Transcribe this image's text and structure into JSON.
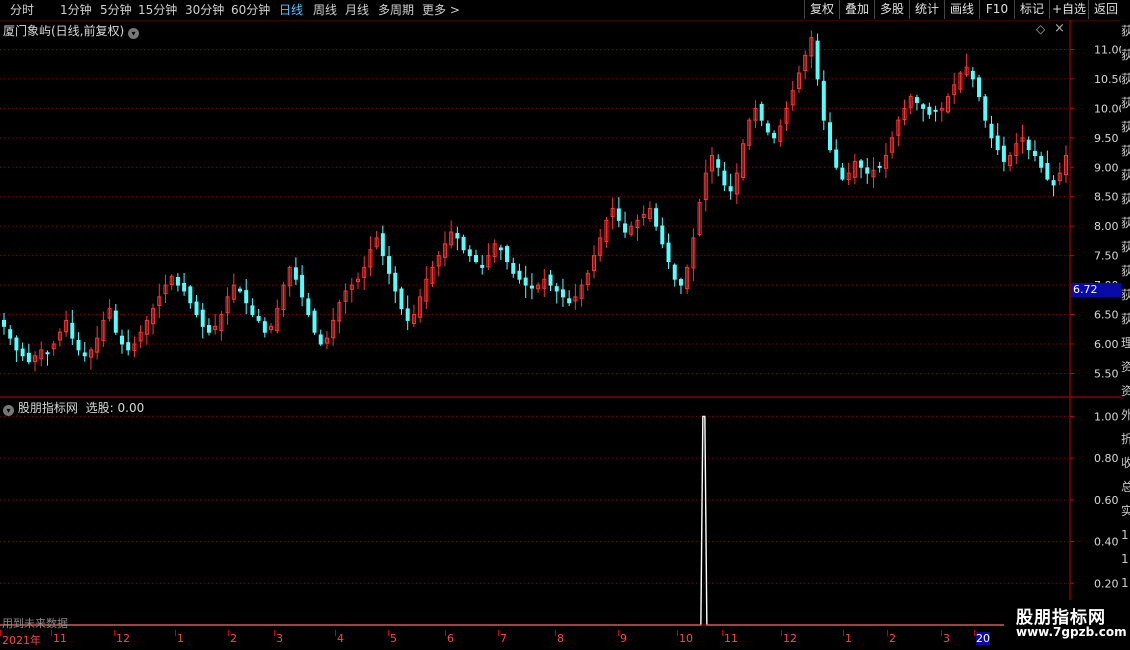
{
  "toolbar": {
    "periods": [
      "分时",
      "1分钟",
      "5分钟",
      "15分钟",
      "30分钟",
      "60分钟",
      "日线",
      "周线",
      "月线",
      "多周期",
      "更多 >"
    ],
    "active_index": 6,
    "right_buttons": [
      "复权",
      "叠加",
      "多股",
      "统计",
      "画线",
      "F10",
      "标记",
      "+自选",
      "返回"
    ]
  },
  "main": {
    "title": "厦门象屿(日线,前复权)",
    "diamond": "◇",
    "close_glyph": "×",
    "current_price": "6.72"
  },
  "indicator": {
    "title": "股朋指标网",
    "value_label": "选股: 0.00"
  },
  "note": "用到未来数据",
  "date_axis": {
    "labels": [
      "2021年",
      "11",
      "12",
      "1",
      "2",
      "3",
      "4",
      "5",
      "6",
      "7",
      "8",
      "9",
      "10",
      "11",
      "12",
      "1",
      "2",
      "3",
      "20"
    ]
  },
  "watermark": {
    "brand": "股朋指标网",
    "url": "www.7gpzb.com"
  },
  "right_panel_glyphs": [
    "荻",
    "荻",
    "荻",
    "荻",
    "荻",
    "荻",
    "荻",
    "荻",
    "荻",
    "荻",
    "荻",
    "荻",
    "荻",
    "理",
    "资",
    "资",
    "外",
    "折",
    "收",
    "总",
    "实",
    "1",
    "1",
    "1",
    "1",
    "1"
  ],
  "colors": {
    "up": "#ff3232",
    "down": "#54ffff",
    "active_tab": "#4fc3ff",
    "grid": "#7a0000",
    "axis": "#c80000",
    "price_tag_bg": "#0a0aa8"
  },
  "chart_data": [
    {
      "type": "candlestick",
      "y_axis_ticks": [
        "11.00",
        "10.50",
        "10.00",
        "9.50",
        "9.00",
        "8.50",
        "8.00",
        "7.50",
        "7.00",
        "6.50",
        "6.00",
        "5.50"
      ],
      "ylim": [
        5.1,
        11.5
      ],
      "close_series": [
        6.3,
        6.1,
        5.9,
        5.8,
        5.7,
        5.8,
        5.9,
        5.85,
        6.0,
        6.2,
        6.4,
        6.1,
        5.9,
        5.8,
        5.9,
        6.1,
        6.4,
        6.6,
        6.2,
        6.0,
        5.9,
        6.0,
        6.2,
        6.4,
        6.6,
        6.8,
        7.0,
        7.15,
        7.0,
        6.9,
        6.7,
        6.5,
        6.3,
        6.2,
        6.3,
        6.5,
        6.8,
        7.0,
        6.9,
        6.7,
        6.5,
        6.4,
        6.2,
        6.3,
        6.6,
        7.0,
        7.3,
        7.1,
        6.8,
        6.5,
        6.2,
        6.0,
        6.1,
        6.4,
        6.7,
        6.9,
        7.0,
        7.1,
        7.3,
        7.6,
        7.8,
        7.5,
        7.2,
        6.9,
        6.6,
        6.4,
        6.5,
        6.8,
        7.1,
        7.3,
        7.5,
        7.7,
        7.9,
        7.8,
        7.6,
        7.5,
        7.4,
        7.3,
        7.5,
        7.7,
        7.6,
        7.4,
        7.2,
        7.1,
        7.0,
        6.95,
        7.0,
        7.1,
        7.0,
        6.9,
        6.8,
        6.7,
        6.8,
        7.0,
        7.2,
        7.5,
        7.8,
        8.1,
        8.3,
        8.1,
        7.9,
        8.0,
        8.1,
        8.2,
        8.3,
        8.0,
        7.7,
        7.4,
        7.1,
        7.0,
        7.3,
        7.8,
        8.4,
        8.9,
        9.2,
        9.0,
        8.7,
        8.6,
        8.9,
        9.4,
        9.8,
        10.0,
        9.8,
        9.6,
        9.5,
        9.7,
        10.0,
        10.3,
        10.6,
        10.9,
        11.2,
        10.5,
        9.8,
        9.3,
        9.0,
        8.8,
        8.9,
        9.1,
        9.0,
        8.9,
        8.95,
        9.0,
        9.2,
        9.5,
        9.8,
        10.0,
        10.2,
        10.1,
        10.0,
        9.9,
        9.95,
        10.0,
        10.2,
        10.4,
        10.6,
        10.7,
        10.5,
        10.2,
        9.8,
        9.5,
        9.3,
        9.1,
        9.2,
        9.4,
        9.5,
        9.3,
        9.2,
        9.0,
        8.8,
        8.7,
        8.9,
        9.2
      ],
      "last_price": 6.72
    },
    {
      "type": "line",
      "name": "选股",
      "y_axis_ticks": [
        "1.00",
        "0.80",
        "0.60",
        "0.40",
        "0.20"
      ],
      "ylim": [
        0,
        1.05
      ],
      "values_nonzero": [
        {
          "bar_fraction": 0.659,
          "value": 1.0
        }
      ],
      "last_value": "0.00"
    }
  ]
}
